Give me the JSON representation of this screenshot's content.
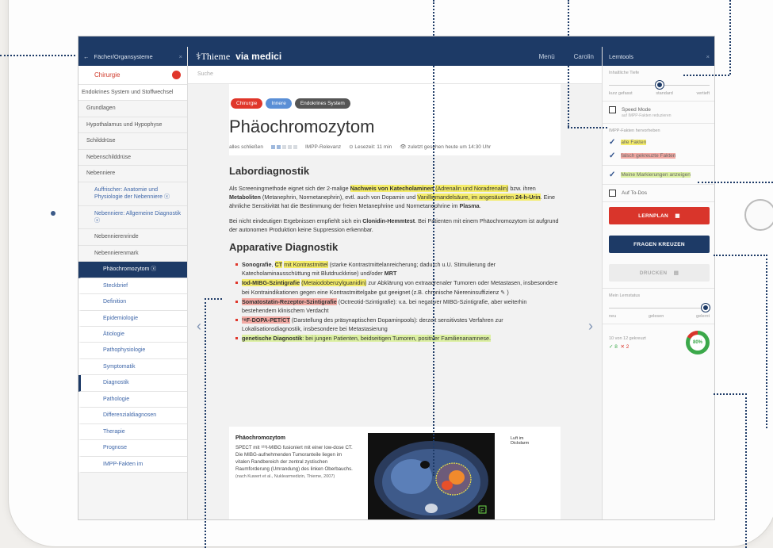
{
  "sidebar": {
    "header": "Fächer/Organsysteme",
    "subject": "Chirurgie",
    "items": [
      {
        "label": "Endokrines System und Stoffwechsel",
        "level": "l0"
      },
      {
        "label": "Grundlagen",
        "level": "l1"
      },
      {
        "label": "Hypothalamus und Hypophyse",
        "level": "l1"
      },
      {
        "label": "Schilddrüse",
        "level": "l1"
      },
      {
        "label": "Nebenschilddrüse",
        "level": "l1"
      },
      {
        "label": "Nebenniere",
        "level": "l1"
      },
      {
        "label": "Auffrischer: Anatomie und Physiologie der Nebenniere ⓧ",
        "level": "l2"
      },
      {
        "label": "Nebenniere: Allgemeine Diagnostik ⓧ",
        "level": "l2"
      },
      {
        "label": "Nebennierenrinde",
        "level": "l1b"
      },
      {
        "label": "Nebennierenmark",
        "level": "l1b"
      },
      {
        "label": "Phäochromozytom ⓧ",
        "level": "active"
      },
      {
        "label": "Steckbrief",
        "level": "l3"
      },
      {
        "label": "Definition",
        "level": "l3"
      },
      {
        "label": "Epidemiologie",
        "level": "l3"
      },
      {
        "label": "Ätiologie",
        "level": "l3"
      },
      {
        "label": "Pathophysiologie",
        "level": "l3"
      },
      {
        "label": "Symptomatik",
        "level": "l3"
      },
      {
        "label": "Diagnostik",
        "level": "l3 bold"
      },
      {
        "label": "Pathologie",
        "level": "l3"
      },
      {
        "label": "Differenzialdiagnosen",
        "level": "l3"
      },
      {
        "label": "Therapie",
        "level": "l3"
      },
      {
        "label": "Prognose",
        "level": "l3"
      },
      {
        "label": "IMPP-Fakten im",
        "level": "l3"
      }
    ]
  },
  "header": {
    "logo": "Thieme",
    "logo_bold": "via medici",
    "menu": "Menü",
    "user": "Carolin"
  },
  "search": {
    "placeholder": "Suche"
  },
  "article": {
    "tags": [
      {
        "label": "Chirurgie",
        "color": "#e0362a"
      },
      {
        "label": "Innere",
        "color": "#5a8fd6"
      },
      {
        "label": "Endokrines System",
        "color": "#555555"
      }
    ],
    "title": "Phäochromozytom",
    "meta_close": "alles schließen",
    "meta_impp": "IMPP-Relevanz",
    "meta_read": "⊙ Lesezeit: 11 min",
    "meta_seen": "👁 zuletzt gesehen heute um 14:30 Uhr",
    "h_labor": "Labordiagnostik",
    "h_app": "Apparative Diagnostik"
  },
  "figure": {
    "title": "Phäochromozytom",
    "caption": "SPECT mit ¹²³I-MIBG fusioniert mit einer low-dose CT. Die MIBG-aufnehmenden Tumoranteile liegen im vitalen Randbereich der zentral zystischen Raumforderung (Umrandung) des linken Oberbauchs.",
    "source": "(nach Kuwert et al., Nuklearmedizin, Thieme, 2007)",
    "label": "Luft im Dickdarm",
    "marker": "F"
  },
  "panel": {
    "header": "Lerntools",
    "depth_label": "Inhaltliche Tiefe",
    "depth_levels": [
      "kurz gefasst",
      "standard",
      "vertieft"
    ],
    "depth_value": 0.5,
    "speed_mode": "Speed Mode",
    "speed_sub": "auf IMPP-Fakten reduzieren",
    "impp_label": "IMPP-Fakten hervorheben",
    "all_facts": "alle Fakten",
    "wrong_facts": "falsch gekreuzte Fakten",
    "my_marks": "Meine Markierungen anzeigen",
    "todo": "Auf To-Dos",
    "btn_lernplan": "LERNPLAN",
    "btn_fragen": "FRAGEN KREUZEN",
    "btn_drucken": "DRUCKEN",
    "status_label": "Mein Lernstatus",
    "status_levels": [
      "neu",
      "gelesen",
      "gelernt"
    ],
    "status_value": 1.0,
    "score_text": "10 von 12 gekreuzt",
    "score_right": "✓ 8",
    "score_wrong": "✕ 2",
    "score_pct": "80%"
  }
}
